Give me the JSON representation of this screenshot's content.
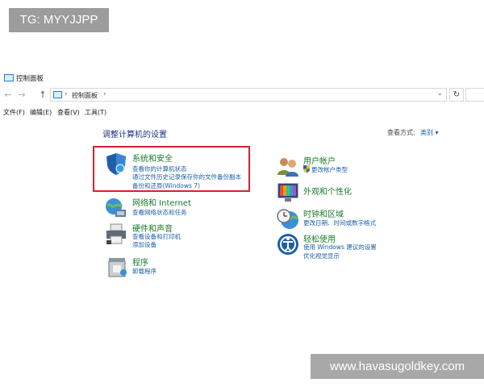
{
  "overlay": {
    "tg_badge": "TG: MYYJJPP",
    "watermark": "www.havasugoldkey.com"
  },
  "window": {
    "title": "控制面板"
  },
  "nav": {
    "back": "←",
    "forward": "→",
    "up": "↑",
    "address_sep": "›",
    "address_path": "控制面板",
    "dropdown": "⌄",
    "refresh": "↻"
  },
  "menu": {
    "file": "文件(F)",
    "edit": "编辑(E)",
    "view": "查看(V)",
    "tools": "工具(T)"
  },
  "content": {
    "title": "调整计算机的设置",
    "view_by_label": "查看方式:",
    "view_by_value": "类别 ▾",
    "categories": [
      {
        "title": "系统和安全",
        "icon": "shield-icon",
        "links": [
          "查看你的计算机状态",
          "通过文件历史记录保存你的文件备份副本",
          "备份和还原(Windows 7)"
        ]
      },
      {
        "title": "网络和 Internet",
        "icon": "network-globe-icon",
        "links": [
          "查看网络状态和任务"
        ]
      },
      {
        "title": "硬件和声音",
        "icon": "printer-icon",
        "links": [
          "查看设备和打印机",
          "添加设备"
        ]
      },
      {
        "title": "程序",
        "icon": "programs-box-icon",
        "links": [
          "卸载程序"
        ]
      },
      {
        "title": "用户帐户",
        "icon": "users-icon",
        "links": [
          "更改帐户类型"
        ]
      },
      {
        "title": "外观和个性化",
        "icon": "display-palette-icon",
        "links": []
      },
      {
        "title": "时钟和区域",
        "icon": "clock-globe-icon",
        "links": [
          "更改日期、时间或数字格式"
        ]
      },
      {
        "title": "轻松使用",
        "icon": "ease-of-access-icon",
        "links": [
          "使用 Windows 建议的设置",
          "优化视觉显示"
        ]
      }
    ]
  },
  "colors": {
    "category_title": "#1a7a2b",
    "link": "#1a5ea8",
    "page_title": "#1e3287",
    "highlight": "#d2242d"
  }
}
